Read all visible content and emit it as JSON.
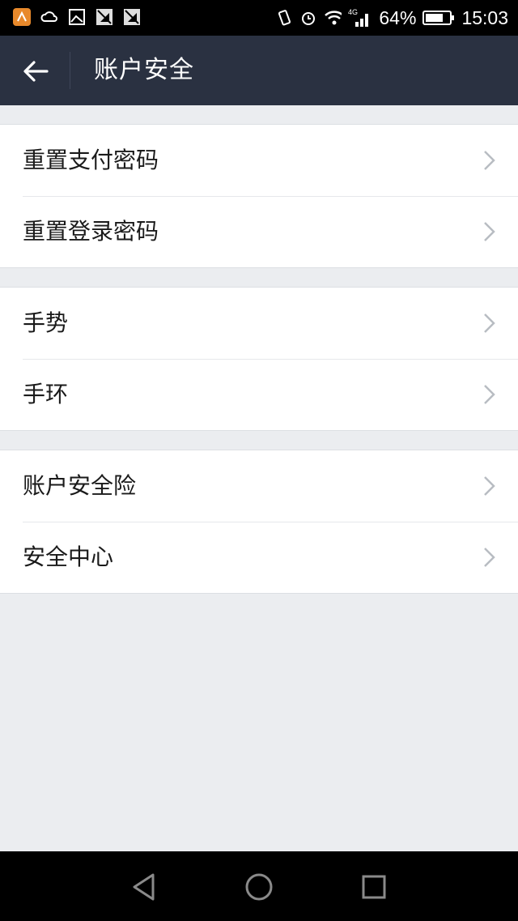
{
  "status_bar": {
    "notification_icons": [
      "app-icon",
      "cloud-icon",
      "image-icon",
      "no-signal-icon",
      "no-signal-icon"
    ],
    "battery_percent": "64%",
    "time": "15:03",
    "network": "4G"
  },
  "header": {
    "title": "账户安全",
    "back_icon": "back-arrow-icon"
  },
  "groups": [
    {
      "items": [
        {
          "label": "重置支付密码"
        },
        {
          "label": "重置登录密码"
        }
      ]
    },
    {
      "items": [
        {
          "label": "手势"
        },
        {
          "label": "手环"
        }
      ]
    },
    {
      "items": [
        {
          "label": "账户安全险"
        },
        {
          "label": "安全中心"
        }
      ]
    }
  ],
  "nav_bar": {
    "buttons": [
      "back-triangle-icon",
      "home-circle-icon",
      "recents-square-icon"
    ]
  },
  "colors": {
    "title_bar": "#2a3141",
    "page_background": "#ebedf0",
    "list_background": "#ffffff",
    "chevron": "#b8bcc2"
  }
}
